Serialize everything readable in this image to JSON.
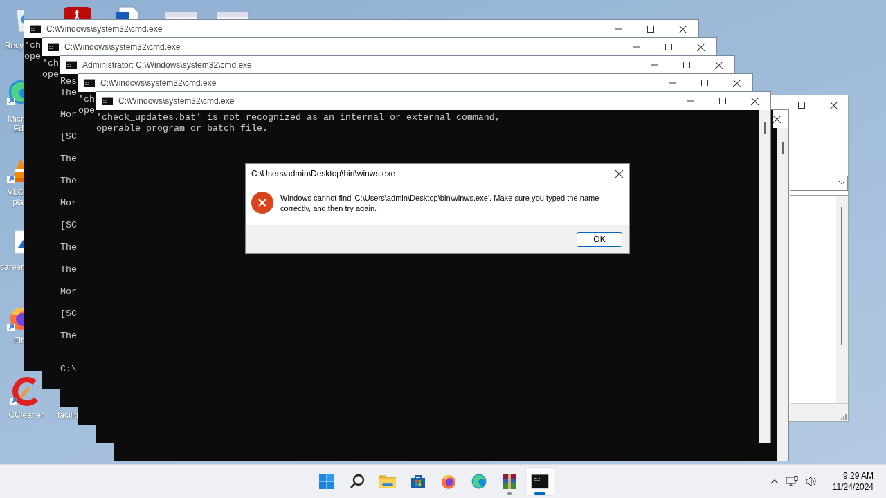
{
  "desktop_icons": [
    {
      "kind": "recycle-bin",
      "label_lines": [
        "Recy"
      ]
    },
    {
      "kind": "edge",
      "label_lines": [
        "Micr",
        "Ed"
      ]
    },
    {
      "kind": "vlc",
      "label_lines": [
        "VLC",
        "pla"
      ]
    },
    {
      "kind": "image",
      "label_lines": [
        "career"
      ]
    },
    {
      "kind": "firefox",
      "label_lines": [
        "Fir"
      ]
    },
    {
      "kind": "ccleaner",
      "label_lines": [
        "CCleaner"
      ]
    },
    {
      "label_lines": [
        "faciliti"
      ]
    },
    {
      "kind": "pdf"
    },
    {
      "kind": "document"
    },
    {
      "kind": "thumbnail"
    },
    {
      "kind": "thumbnail"
    }
  ],
  "windows": [
    {
      "title": "C:\\Windows\\system32\\cmd.exe",
      "lines": [
        {
          "text": "'ch"
        },
        {
          "text": "ope"
        }
      ]
    },
    {
      "title": "C:\\Windows\\system32\\cmd.exe",
      "lines": [
        {
          "text": "'ch"
        },
        {
          "text": "ope"
        }
      ]
    },
    {
      "title": "Administrator: C:\\Windows\\system32\\cmd.exe",
      "lines": [
        {
          "text": "Res"
        },
        {
          "text": "The"
        },
        {
          "kind": "blank"
        },
        {
          "text": "Mor"
        },
        {
          "kind": "blank"
        },
        {
          "text": "[SC"
        },
        {
          "kind": "blank"
        },
        {
          "text": "The"
        },
        {
          "kind": "blank"
        },
        {
          "text": "The"
        },
        {
          "kind": "blank"
        },
        {
          "text": "Mor"
        },
        {
          "kind": "blank"
        },
        {
          "text": "[SC"
        },
        {
          "kind": "blank"
        },
        {
          "text": "The"
        },
        {
          "kind": "blank"
        },
        {
          "text": "The"
        },
        {
          "kind": "blank"
        },
        {
          "text": "Mor"
        },
        {
          "kind": "blank"
        },
        {
          "text": "[SC"
        },
        {
          "kind": "blank"
        },
        {
          "text": "The"
        },
        {
          "kind": "blank"
        },
        {
          "kind": "blank"
        },
        {
          "text": "C:\\"
        }
      ]
    },
    {
      "title": "C:\\Windows\\system32\\cmd.exe",
      "lines": [
        {
          "text": "'ch"
        },
        {
          "text": "ope"
        }
      ]
    },
    {
      "title": "C:\\Windows\\system32\\cmd.exe",
      "lines": [
        {
          "text": "'check_updates.bat' is not recognized as an internal or external command,"
        },
        {
          "text": "operable program or batch file."
        }
      ]
    }
  ],
  "dialog": {
    "title": "C:\\Users\\admin\\Desktop\\bin\\winws.exe",
    "message": "Windows cannot find 'C:\\Users\\admin\\Desktop\\bin\\winws.exe'. Make sure you typed the name correctly, and then try again.",
    "button": "OK"
  },
  "taskbar": {
    "apps": [
      {
        "kind": "start",
        "running": false,
        "selected": false
      },
      {
        "kind": "search",
        "running": false,
        "selected": false
      },
      {
        "kind": "folder",
        "running": false,
        "selected": false
      },
      {
        "kind": "store",
        "running": false,
        "selected": false
      },
      {
        "kind": "firefox",
        "running": false,
        "selected": false
      },
      {
        "kind": "edge",
        "running": false,
        "selected": false
      },
      {
        "kind": "winrar",
        "running": true,
        "selected": false
      },
      {
        "kind": "terminal",
        "running": true,
        "selected": true
      }
    ],
    "time": "9:29 AM",
    "date": "11/24/2024"
  }
}
